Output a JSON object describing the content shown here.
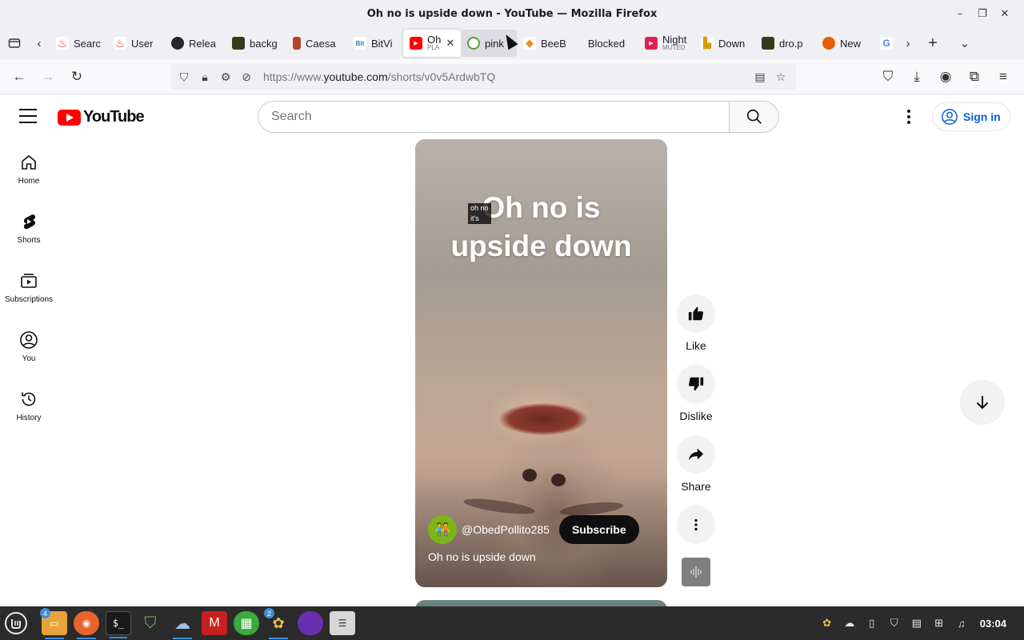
{
  "window": {
    "title": "Oh no is upside down - YouTube — Mozilla Firefox",
    "controls": [
      "–",
      "❐",
      "✕"
    ]
  },
  "tabs": [
    {
      "label": "Searc",
      "fav_color": "#e0201b",
      "fav": "♨"
    },
    {
      "label": "User",
      "fav_color": "#e0201b",
      "fav": "♨"
    },
    {
      "label": "Relea",
      "fav_color": "#24292f",
      "fav": "●"
    },
    {
      "label": "backg",
      "fav_color": "#3a3a1a",
      "fav": "▦"
    },
    {
      "label": "Caesa",
      "fav_color": "#b0462c",
      "fav": "▮"
    },
    {
      "label": "BitVi",
      "fav_color": "#2e7bc4",
      "fav": "Bit"
    },
    {
      "label": "Oh",
      "sublabel": "PLA",
      "fav_color": "#ff0000",
      "fav": "▶",
      "active": true
    },
    {
      "label": "pink",
      "fav_color": "#5aa02c",
      "fav": "G",
      "hover": true
    },
    {
      "label": "BeeB",
      "fav_color": "#f08a24",
      "fav": "◆"
    },
    {
      "label": "Blocked",
      "fav_color": "",
      "fav": ""
    },
    {
      "label": "Night",
      "sublabel": "MUTED",
      "fav_color": "#e0204e",
      "fav": "▶"
    },
    {
      "label": "Down",
      "fav_color": "#d99a00",
      "fav": "▙"
    },
    {
      "label": "dro.p",
      "fav_color": "#3a3a1a",
      "fav": "▦"
    },
    {
      "label": "New",
      "fav_color": "#e66000",
      "fav": "◉"
    },
    {
      "label": "",
      "fav_color": "#ffffff",
      "fav": "G"
    }
  ],
  "navbar": {
    "url_prefix": "https://www.",
    "url_host": "youtube.com",
    "url_path": "/shorts/v0v5ArdwbTQ"
  },
  "youtube": {
    "logo_text": "YouTube",
    "search_placeholder": "Search",
    "signin_label": "Sign in",
    "sidebar": [
      {
        "label": "Home",
        "icon": "home-icon"
      },
      {
        "label": "Shorts",
        "icon": "shorts-icon"
      },
      {
        "label": "Subscriptions",
        "icon": "subscriptions-icon"
      },
      {
        "label": "You",
        "icon": "you-icon"
      },
      {
        "label": "History",
        "icon": "history-icon"
      }
    ],
    "short": {
      "overlay_line1": "Oh no is",
      "overlay_line2": "upside down",
      "caption_line1": "oh no",
      "caption_line2": "it's",
      "channel_handle": "@ObedPollito285",
      "subscribe_label": "Subscribe",
      "title": "Oh no is upside down"
    },
    "actions": {
      "like": "Like",
      "dislike": "Dislike",
      "share": "Share"
    }
  },
  "taskbar": {
    "items": [
      {
        "name": "files",
        "badge": "4",
        "color": "#e8a33c"
      },
      {
        "name": "firefox",
        "badge": "",
        "color": "#e8662c"
      },
      {
        "name": "terminal",
        "badge": "",
        "color": "#1a1a1a"
      },
      {
        "name": "shield",
        "badge": "",
        "color": "#2f6b3a"
      },
      {
        "name": "cloud",
        "badge": "",
        "color": "#3a6ea5"
      },
      {
        "name": "mario",
        "badge": "",
        "color": "#c82020"
      },
      {
        "name": "calc",
        "badge": "",
        "color": "#3caa3c"
      },
      {
        "name": "bee",
        "badge": "2",
        "color": "#3a3a3a"
      },
      {
        "name": "orb",
        "badge": "",
        "color": "#6a2fb0"
      },
      {
        "name": "settings",
        "badge": "",
        "color": "#d8d8d8"
      }
    ],
    "clock": "03:04"
  }
}
